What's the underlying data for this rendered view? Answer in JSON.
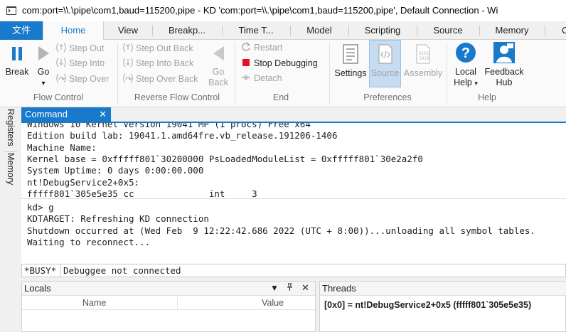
{
  "window": {
    "title": "com:port=\\\\.\\pipe\\com1,baud=115200,pipe - KD 'com:port=\\\\.\\pipe\\com1,baud=115200,pipe', Default Connection  - Wi"
  },
  "tabs": {
    "file": "文件",
    "home": "Home",
    "view": "View",
    "breakpoints": "Breakp...",
    "time_travel": "Time T...",
    "model": "Model",
    "scripting": "Scripting",
    "source": "Source",
    "memory": "Memory",
    "more": "C"
  },
  "ribbon": {
    "break_label": "Break",
    "go_label": "Go",
    "step_out": "Step Out",
    "step_into": "Step Into",
    "step_over": "Step Over",
    "step_out_back": "Step Out Back",
    "step_into_back": "Step Into Back",
    "step_over_back": "Step Over Back",
    "go_back_line1": "Go",
    "go_back_line2": "Back",
    "restart": "Restart",
    "stop_debugging": "Stop Debugging",
    "detach": "Detach",
    "settings": "Settings",
    "source": "Source",
    "assembly": "Assembly",
    "local_help_line1": "Local",
    "local_help_line2": "Help",
    "feedback_hub_line1": "Feedback",
    "feedback_hub_line2": "Hub",
    "groups": {
      "flow_control": "Flow Control",
      "reverse_flow_control": "Reverse Flow Control",
      "end": "End",
      "preferences": "Preferences",
      "help": "Help"
    }
  },
  "side_tabs": {
    "registers": "Registers",
    "memory": "Memory"
  },
  "command": {
    "tab_title": "Command",
    "output_lines": [
      "Windows 10 Kernel Version 19041 MP (1 procs) Free x64",
      "Edition build lab: 19041.1.amd64fre.vb_release.191206-1406",
      "Machine Name:",
      "Kernel base = 0xfffff801`30200000 PsLoadedModuleList = 0xfffff801`30e2a2f0",
      "System Uptime: 0 days 0:00:00.000",
      "nt!DebugService2+0x5:",
      "fffff801`305e5e35 cc              int     3",
      "kd> g",
      "KDTARGET: Refreshing KD connection",
      "Shutdown occurred at (Wed Feb  9 12:22:42.686 2022 (UTC + 8:00))...unloading all symbol tables.",
      "Waiting to reconnect..."
    ],
    "busy_label": "*BUSY*",
    "input_status": "Debuggee not connected"
  },
  "locals": {
    "title": "Locals",
    "col_name": "Name",
    "col_value": "Value"
  },
  "threads": {
    "title": "Threads",
    "row": "[0x0] = nt!DebugService2+0x5 (fffff801`305e5e35)"
  },
  "colors": {
    "accent": "#1979ca",
    "stop_red": "#e81123"
  }
}
